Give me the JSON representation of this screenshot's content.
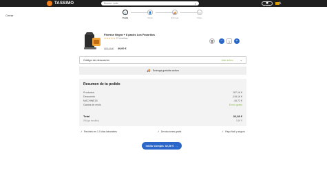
{
  "header": {
    "brand": "TASSIMO",
    "search_placeholder": "Buscar: Latte,",
    "icons": [
      {
        "name": "account-icon",
        "glyph": "◉",
        "label": "Mi cuenta"
      },
      {
        "name": "user-icon",
        "glyph": "♙",
        "label": ""
      }
    ],
    "pill_label": "0"
  },
  "close_label": "Cerrar",
  "steps": [
    {
      "icon": "🛒",
      "label": "Cesta",
      "active": true
    },
    {
      "icon": "👤",
      "label": "Iniciar",
      "active": false
    },
    {
      "icon": "🚚",
      "label": "Entrega",
      "active": false
    },
    {
      "icon": "▭",
      "label": "Pago",
      "active": false
    }
  ],
  "product": {
    "name": "Finesse Negra + 8 packs Los Favoritos",
    "stars": "★★★★★",
    "reviews": "27 reseñas",
    "old_price": "167,16 €",
    "new_price": "49,00 €",
    "quantity": "1",
    "trash_icon": "🗑",
    "minus": "−",
    "plus": "+"
  },
  "discount": {
    "label": "Código de descuento",
    "state": "Vale activo",
    "chevron": "⌄"
  },
  "delivery": {
    "icon": "🚚",
    "text": "Entrega gratuita activa"
  },
  "summary": {
    "title": "Resumen de tu pedido",
    "rows": [
      {
        "label": "Productos",
        "value": "167,16 €"
      },
      {
        "label": "Descuento",
        "value": "-118,16 €"
      },
      {
        "label": "MACHINE18",
        "value": "-16,72 €"
      },
      {
        "label": "Gastos de envío",
        "value": "Envío gratis"
      }
    ],
    "total_label": "Total",
    "total_value": "32,28 €",
    "vat_label": "IVA (ya incluido)",
    "vat_value": "5,60 €"
  },
  "benefits": [
    "Recíbelo en 1-5 días laborables",
    "Devoluciones gratis",
    "Pago fácil y seguro"
  ],
  "cta": {
    "label": "Iniciar compra",
    "amount": "32,28 €",
    "icon": "→"
  }
}
